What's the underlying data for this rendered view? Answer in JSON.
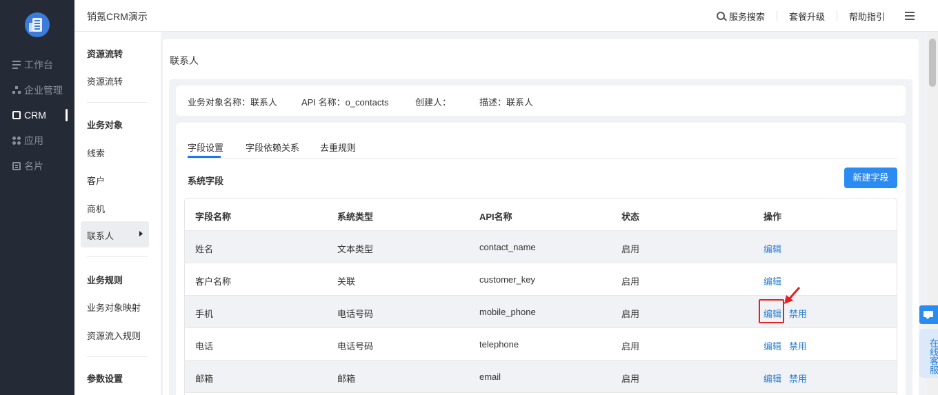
{
  "brand": "销氪CRM演示",
  "top_links": {
    "search": "服务搜索",
    "upgrade": "套餐升级",
    "help": "帮助指引"
  },
  "nav": [
    {
      "label": "工作台",
      "icon": "dashboard-icon"
    },
    {
      "label": "企业管理",
      "icon": "org-icon"
    },
    {
      "label": "CRM",
      "icon": "crm-icon",
      "active": true
    },
    {
      "label": "应用",
      "icon": "apps-icon"
    },
    {
      "label": "名片",
      "icon": "card-icon"
    }
  ],
  "subnav": {
    "group1": "资源流转",
    "group1_items": [
      "资源流转"
    ],
    "group2": "业务对象",
    "group2_items": [
      "线索",
      "客户",
      "商机",
      "联系人"
    ],
    "group3": "业务规则",
    "group3_items": [
      "业务对象映射",
      "资源流入规则"
    ],
    "group4": "参数设置"
  },
  "page": {
    "title": "联系人",
    "info": {
      "object_name": "业务对象名称：联系人",
      "api_name": "API 名称：o_contacts",
      "creator": "创建人：",
      "desc": "描述：联系人"
    },
    "tabs": [
      "字段设置",
      "字段依赖关系",
      "去重规则"
    ],
    "section_title": "系统字段",
    "new_button": "新建字段"
  },
  "table": {
    "headers": [
      "字段名称",
      "系统类型",
      "API名称",
      "状态",
      "操作"
    ],
    "rows": [
      {
        "name": "姓名",
        "type": "文本类型",
        "api": "contact_name",
        "status": "启用",
        "edit": "编辑",
        "disable": ""
      },
      {
        "name": "客户名称",
        "type": "关联",
        "api": "customer_key",
        "status": "启用",
        "edit": "编辑",
        "disable": ""
      },
      {
        "name": "手机",
        "type": "电话号码",
        "api": "mobile_phone",
        "status": "启用",
        "edit": "编辑",
        "disable": "禁用"
      },
      {
        "name": "电话",
        "type": "电话号码",
        "api": "telephone",
        "status": "启用",
        "edit": "编辑",
        "disable": "禁用"
      },
      {
        "name": "邮箱",
        "type": "邮箱",
        "api": "email",
        "status": "启用",
        "edit": "编辑",
        "disable": "禁用"
      }
    ]
  },
  "service_label": "在线客服",
  "colors": {
    "nav_bg": "#252a37",
    "accent": "#2a8bf2",
    "link": "#2a7fd4",
    "highlight": "#e42020"
  }
}
